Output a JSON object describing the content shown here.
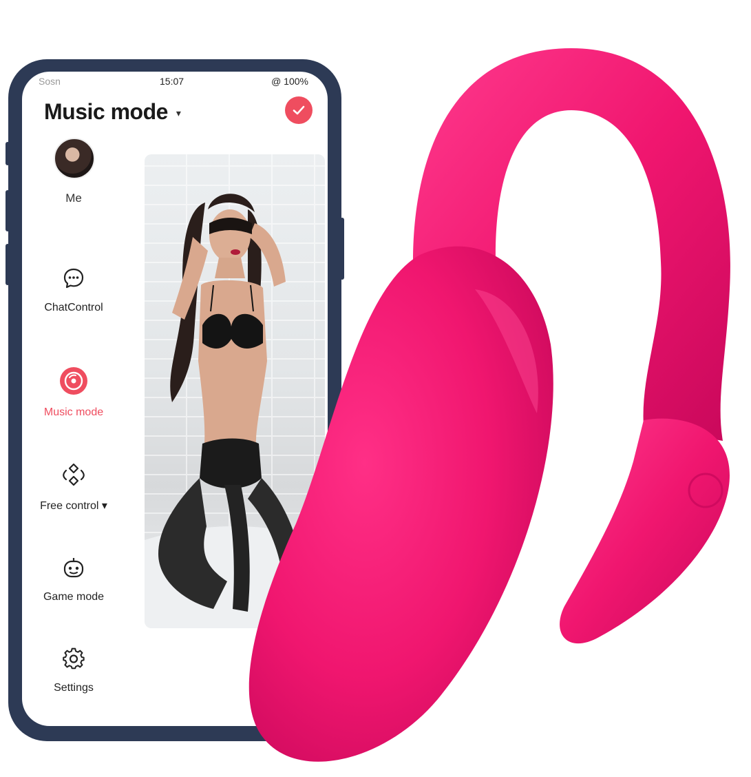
{
  "status_bar": {
    "carrier": "Sosn",
    "time": "15:07",
    "battery": "@ 100%"
  },
  "header": {
    "title": "Music mode",
    "title_caret": "▾",
    "confirm_icon": "check-icon"
  },
  "profile": {
    "label": "Me"
  },
  "menu": [
    {
      "label": "ChatControl",
      "icon": "chat-bubble-icon",
      "active": false
    },
    {
      "label": "Music mode",
      "icon": "music-disc-icon",
      "active": true
    },
    {
      "label": "Free control ▾",
      "icon": "free-control-icon",
      "active": false
    },
    {
      "label": "Game mode",
      "icon": "robot-face-icon",
      "active": false
    },
    {
      "label": "Settings",
      "icon": "gear-icon",
      "active": false
    }
  ],
  "colors": {
    "accent": "#ef4d5f",
    "phone_frame": "#2d3a55",
    "product_pink": "#f0166f"
  }
}
